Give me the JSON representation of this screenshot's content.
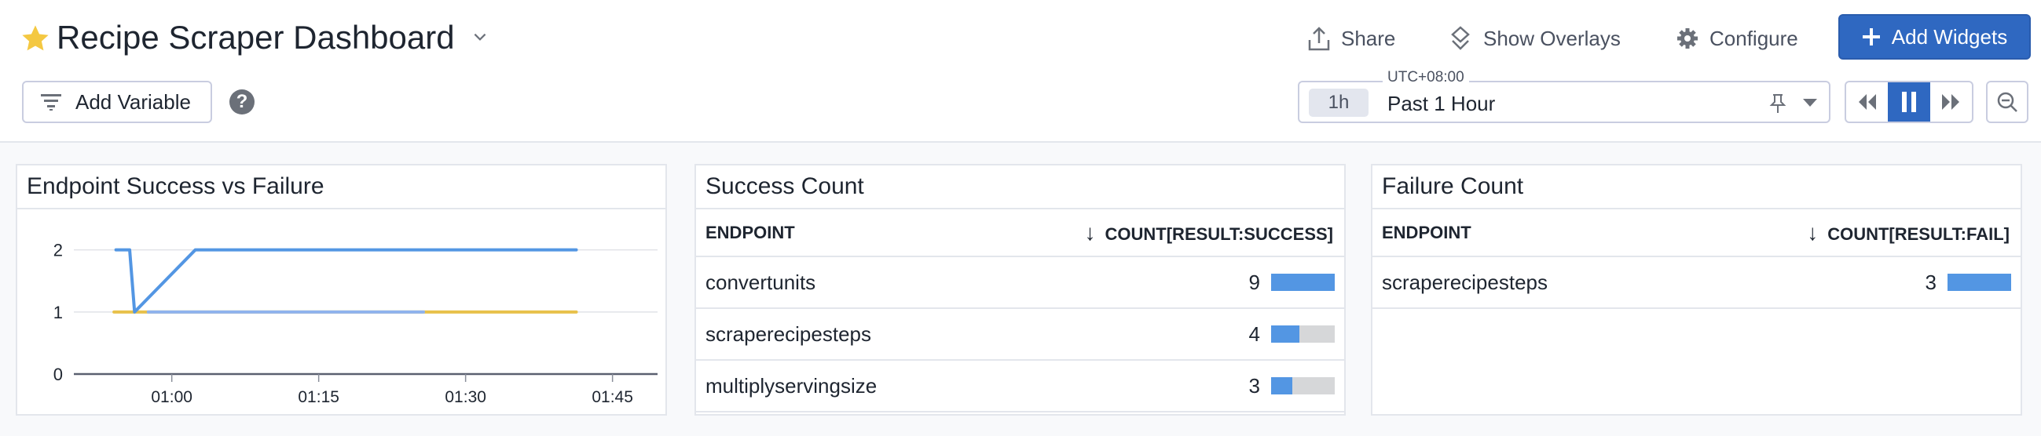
{
  "header": {
    "title": "Recipe Scraper Dashboard",
    "add_variable": "Add Variable",
    "help": "?",
    "share": "Share",
    "show_overlays": "Show Overlays",
    "configure": "Configure",
    "add_widgets": "Add Widgets"
  },
  "time_picker": {
    "timezone": "UTC+08:00",
    "chip": "1h",
    "label": "Past 1 Hour"
  },
  "colors": {
    "accent": "#2f68c1",
    "star": "#f4c842",
    "series_blue": "#5396e3",
    "series_light": "#8fb3ee",
    "series_yellow": "#e8c14a"
  },
  "chart_panel": {
    "title": "Endpoint Success vs Failure"
  },
  "chart_data": {
    "type": "line",
    "title": "Endpoint Success vs Failure",
    "xlabel": "",
    "ylabel": "",
    "x_unit": "minutes since 00:00",
    "xlim": [
      50,
      109.6
    ],
    "ylim": [
      0,
      2.4
    ],
    "yticks": [
      0,
      1,
      2
    ],
    "ytick_labels": [
      "0",
      "1",
      "2"
    ],
    "xticks": [
      60,
      75,
      90,
      105
    ],
    "xtick_labels": [
      "01:00",
      "01:15",
      "01:30",
      "01:45"
    ],
    "grid": true,
    "series": [
      {
        "color": "#e8c14a",
        "points": [
          [
            54.1,
            1
          ],
          [
            101.3,
            1
          ]
        ]
      },
      {
        "color": "#8fb3ee",
        "points": [
          [
            57.6,
            1
          ],
          [
            85.7,
            1
          ]
        ]
      },
      {
        "color": "#5396e3",
        "points": [
          [
            54.3,
            2
          ],
          [
            55.7,
            2
          ],
          [
            56.2,
            1
          ],
          [
            62.4,
            2
          ],
          [
            101.3,
            2
          ]
        ]
      }
    ]
  },
  "success_panel": {
    "title": "Success Count",
    "col_endpoint": "ENDPOINT",
    "col_count": "COUNT[RESULT:SUCCESS]",
    "sort_icon": "↓",
    "max": 9,
    "rows": [
      {
        "endpoint": "convertunits",
        "count": "9",
        "value": 9
      },
      {
        "endpoint": "scraperecipesteps",
        "count": "4",
        "value": 4
      },
      {
        "endpoint": "multiplyservingsize",
        "count": "3",
        "value": 3
      }
    ]
  },
  "failure_panel": {
    "title": "Failure Count",
    "col_endpoint": "ENDPOINT",
    "col_count": "COUNT[RESULT:FAIL]",
    "sort_icon": "↓",
    "max": 3,
    "rows": [
      {
        "endpoint": "scraperecipesteps",
        "count": "3",
        "value": 3
      }
    ]
  }
}
